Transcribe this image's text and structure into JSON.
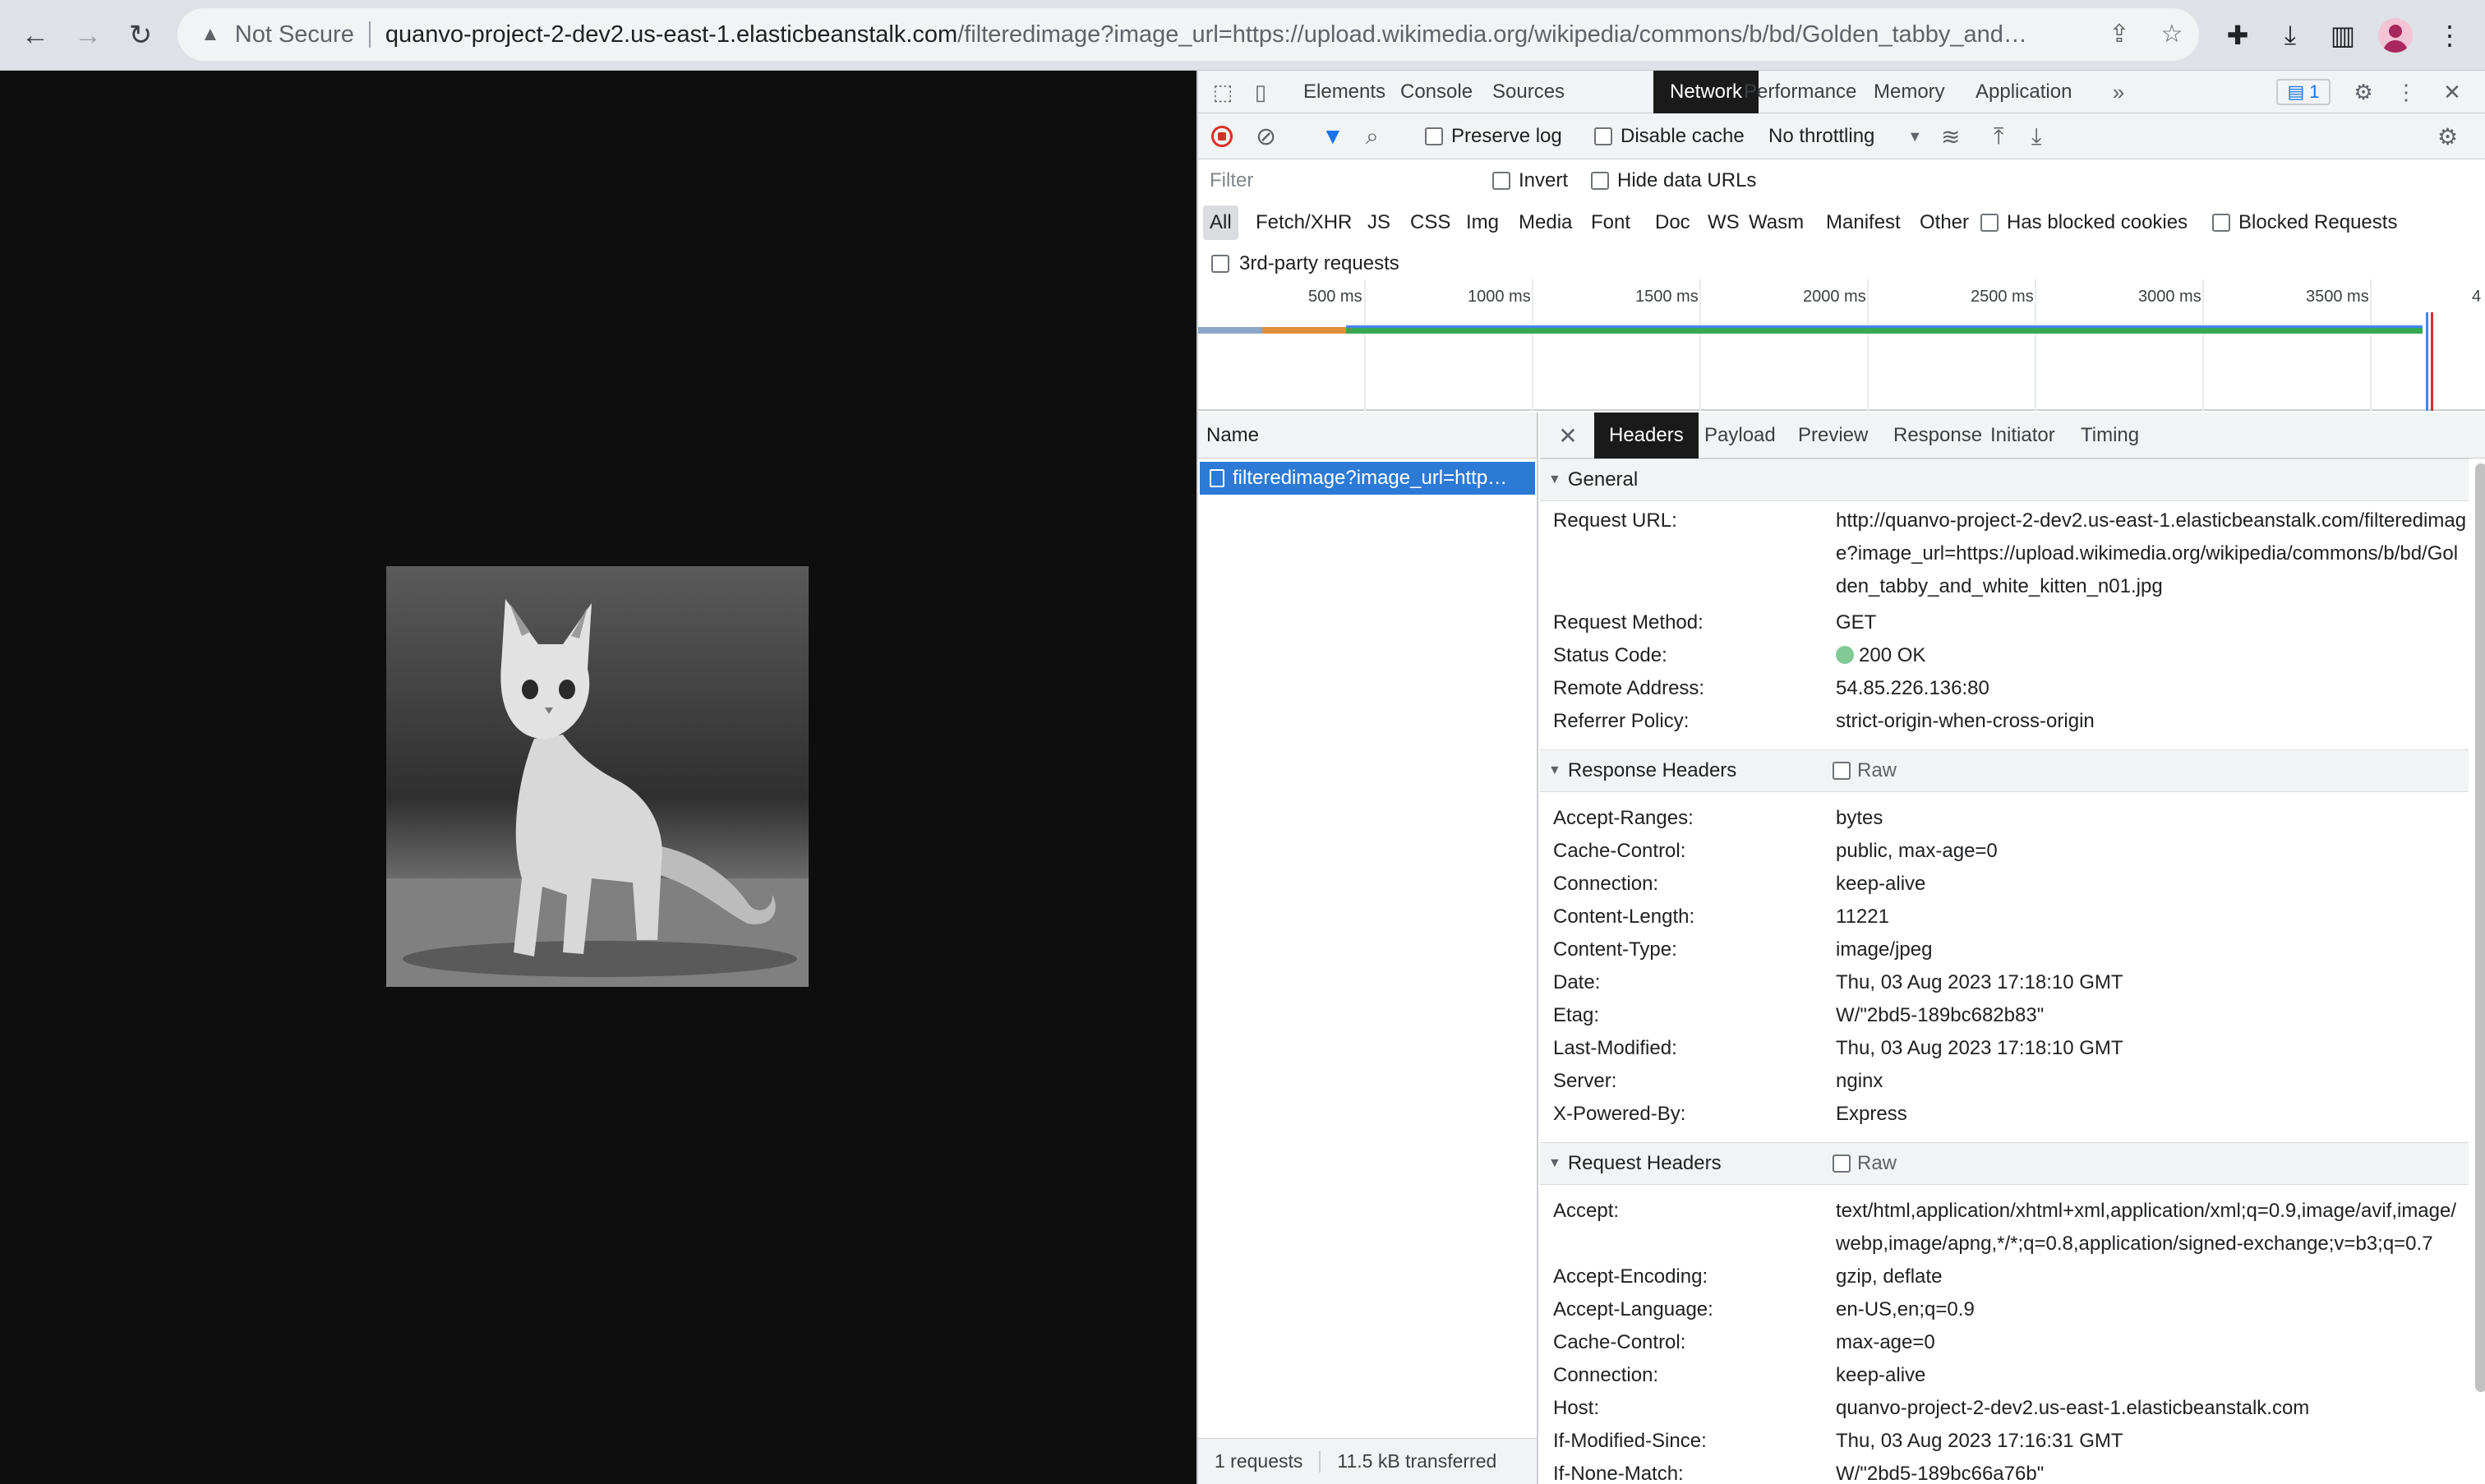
{
  "browser": {
    "security_label": "Not Secure",
    "url_host": "quanvo-project-2-dev2.us-east-1.elasticbeanstalk.com",
    "url_path": "/filteredimage?image_url=https://upload.wikimedia.org/wikipedia/commons/b/bd/Golden_tabby_and…",
    "icons": [
      "back-arrow",
      "forward-arrow",
      "reload",
      "share",
      "bookmark-star",
      "extensions-puzzle",
      "download",
      "side-panel",
      "profile-avatar",
      "kebab-menu"
    ]
  },
  "devtools": {
    "tabs": [
      "Elements",
      "Console",
      "Sources",
      "Network",
      "Performance",
      "Memory",
      "Application"
    ],
    "active_tab": "Network",
    "issues_count": "1",
    "toolbar": {
      "preserve_log": "Preserve log",
      "disable_cache": "Disable cache",
      "throttling": "No throttling"
    },
    "filter": {
      "placeholder": "Filter",
      "invert": "Invert",
      "hide_data_urls": "Hide data URLs"
    },
    "types": [
      "All",
      "Fetch/XHR",
      "JS",
      "CSS",
      "Img",
      "Media",
      "Font",
      "Doc",
      "WS",
      "Wasm",
      "Manifest",
      "Other"
    ],
    "has_blocked_cookies": "Has blocked cookies",
    "blocked_requests": "Blocked Requests",
    "third_party": "3rd-party requests",
    "timeline_ticks": [
      "500 ms",
      "1000 ms",
      "1500 ms",
      "2000 ms",
      "2500 ms",
      "3000 ms",
      "3500 ms",
      "4"
    ],
    "name_header": "Name",
    "request_name": "filteredimage?image_url=http…",
    "summary": {
      "requests": "1 requests",
      "transferred": "11.5 kB transferred"
    },
    "detail_tabs": [
      "Headers",
      "Payload",
      "Preview",
      "Response",
      "Initiator",
      "Timing"
    ],
    "active_detail_tab": "Headers",
    "general": {
      "title": "General",
      "rows": [
        {
          "k": "Request URL:",
          "v": "http://quanvo-project-2-dev2.us-east-1.elasticbeanstalk.com/filteredimage?image_url=https://upload.wikimedia.org/wikipedia/commons/b/bd/Golden_tabby_and_white_kitten_n01.jpg"
        },
        {
          "k": "Request Method:",
          "v": "GET"
        },
        {
          "k": "Status Code:",
          "v": "200 OK"
        },
        {
          "k": "Remote Address:",
          "v": "54.85.226.136:80"
        },
        {
          "k": "Referrer Policy:",
          "v": "strict-origin-when-cross-origin"
        }
      ]
    },
    "response_headers": {
      "title": "Response Headers",
      "raw": "Raw",
      "rows": [
        {
          "k": "Accept-Ranges:",
          "v": "bytes"
        },
        {
          "k": "Cache-Control:",
          "v": "public, max-age=0"
        },
        {
          "k": "Connection:",
          "v": "keep-alive"
        },
        {
          "k": "Content-Length:",
          "v": "11221"
        },
        {
          "k": "Content-Type:",
          "v": "image/jpeg"
        },
        {
          "k": "Date:",
          "v": "Thu, 03 Aug 2023 17:18:10 GMT"
        },
        {
          "k": "Etag:",
          "v": "W/\"2bd5-189bc682b83\""
        },
        {
          "k": "Last-Modified:",
          "v": "Thu, 03 Aug 2023 17:18:10 GMT"
        },
        {
          "k": "Server:",
          "v": "nginx"
        },
        {
          "k": "X-Powered-By:",
          "v": "Express"
        }
      ]
    },
    "request_headers": {
      "title": "Request Headers",
      "raw": "Raw",
      "rows": [
        {
          "k": "Accept:",
          "v": "text/html,application/xhtml+xml,application/xml;q=0.9,image/avif,image/webp,image/apng,*/*;q=0.8,application/signed-exchange;v=b3;q=0.7"
        },
        {
          "k": "Accept-Encoding:",
          "v": "gzip, deflate"
        },
        {
          "k": "Accept-Language:",
          "v": "en-US,en;q=0.9"
        },
        {
          "k": "Cache-Control:",
          "v": "max-age=0"
        },
        {
          "k": "Connection:",
          "v": "keep-alive"
        },
        {
          "k": "Host:",
          "v": "quanvo-project-2-dev2.us-east-1.elasticbeanstalk.com"
        },
        {
          "k": "If-Modified-Since:",
          "v": "Thu, 03 Aug 2023 17:16:31 GMT"
        },
        {
          "k": "If-None-Match:",
          "v": "W/\"2bd5-189bc66a76b\""
        }
      ]
    }
  }
}
